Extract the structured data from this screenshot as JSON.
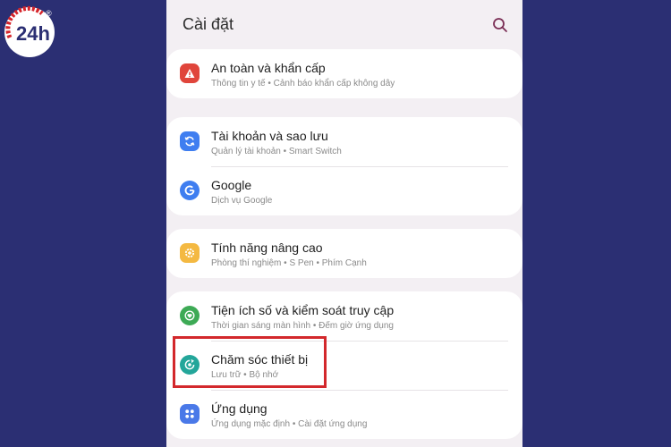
{
  "header": {
    "title": "Cài đặt"
  },
  "logo": {
    "text": "24h",
    "mark": "®"
  },
  "groups": [
    {
      "items": [
        {
          "label": "An toàn và khẩn cấp",
          "sub": "Thông tin y tế • Cảnh báo khẩn cấp không dây",
          "icon": "alert-icon",
          "color": "#e0453b"
        }
      ]
    },
    {
      "items": [
        {
          "label": "Tài khoản và sao lưu",
          "sub": "Quản lý tài khoản • Smart Switch",
          "icon": "sync-icon",
          "color": "#3f7ef0"
        },
        {
          "label": "Google",
          "sub": "Dịch vụ Google",
          "icon": "google-icon",
          "color": "#3f7ef0"
        }
      ]
    },
    {
      "items": [
        {
          "label": "Tính năng nâng cao",
          "sub": "Phòng thí nghiệm • S Pen • Phím Cạnh",
          "icon": "gear-plus-icon",
          "color": "#f4b942"
        }
      ]
    },
    {
      "items": [
        {
          "label": "Tiện ích số và kiểm soát truy cập",
          "sub": "Thời gian sáng màn hình • Đếm giờ ứng dụng",
          "icon": "wellbeing-icon",
          "color": "#3daa55"
        },
        {
          "label": "Chăm sóc thiết bị",
          "sub": "Lưu trữ • Bộ nhớ",
          "icon": "device-care-icon",
          "color": "#23a69a"
        },
        {
          "label": "Ứng dụng",
          "sub": "Ứng dụng mặc định • Cài đặt ứng dụng",
          "icon": "apps-icon",
          "color": "#4a79e8"
        }
      ]
    }
  ],
  "colors": {
    "background": "#2b2f73",
    "panel": "#f3eff3",
    "highlight": "#d3282c"
  }
}
